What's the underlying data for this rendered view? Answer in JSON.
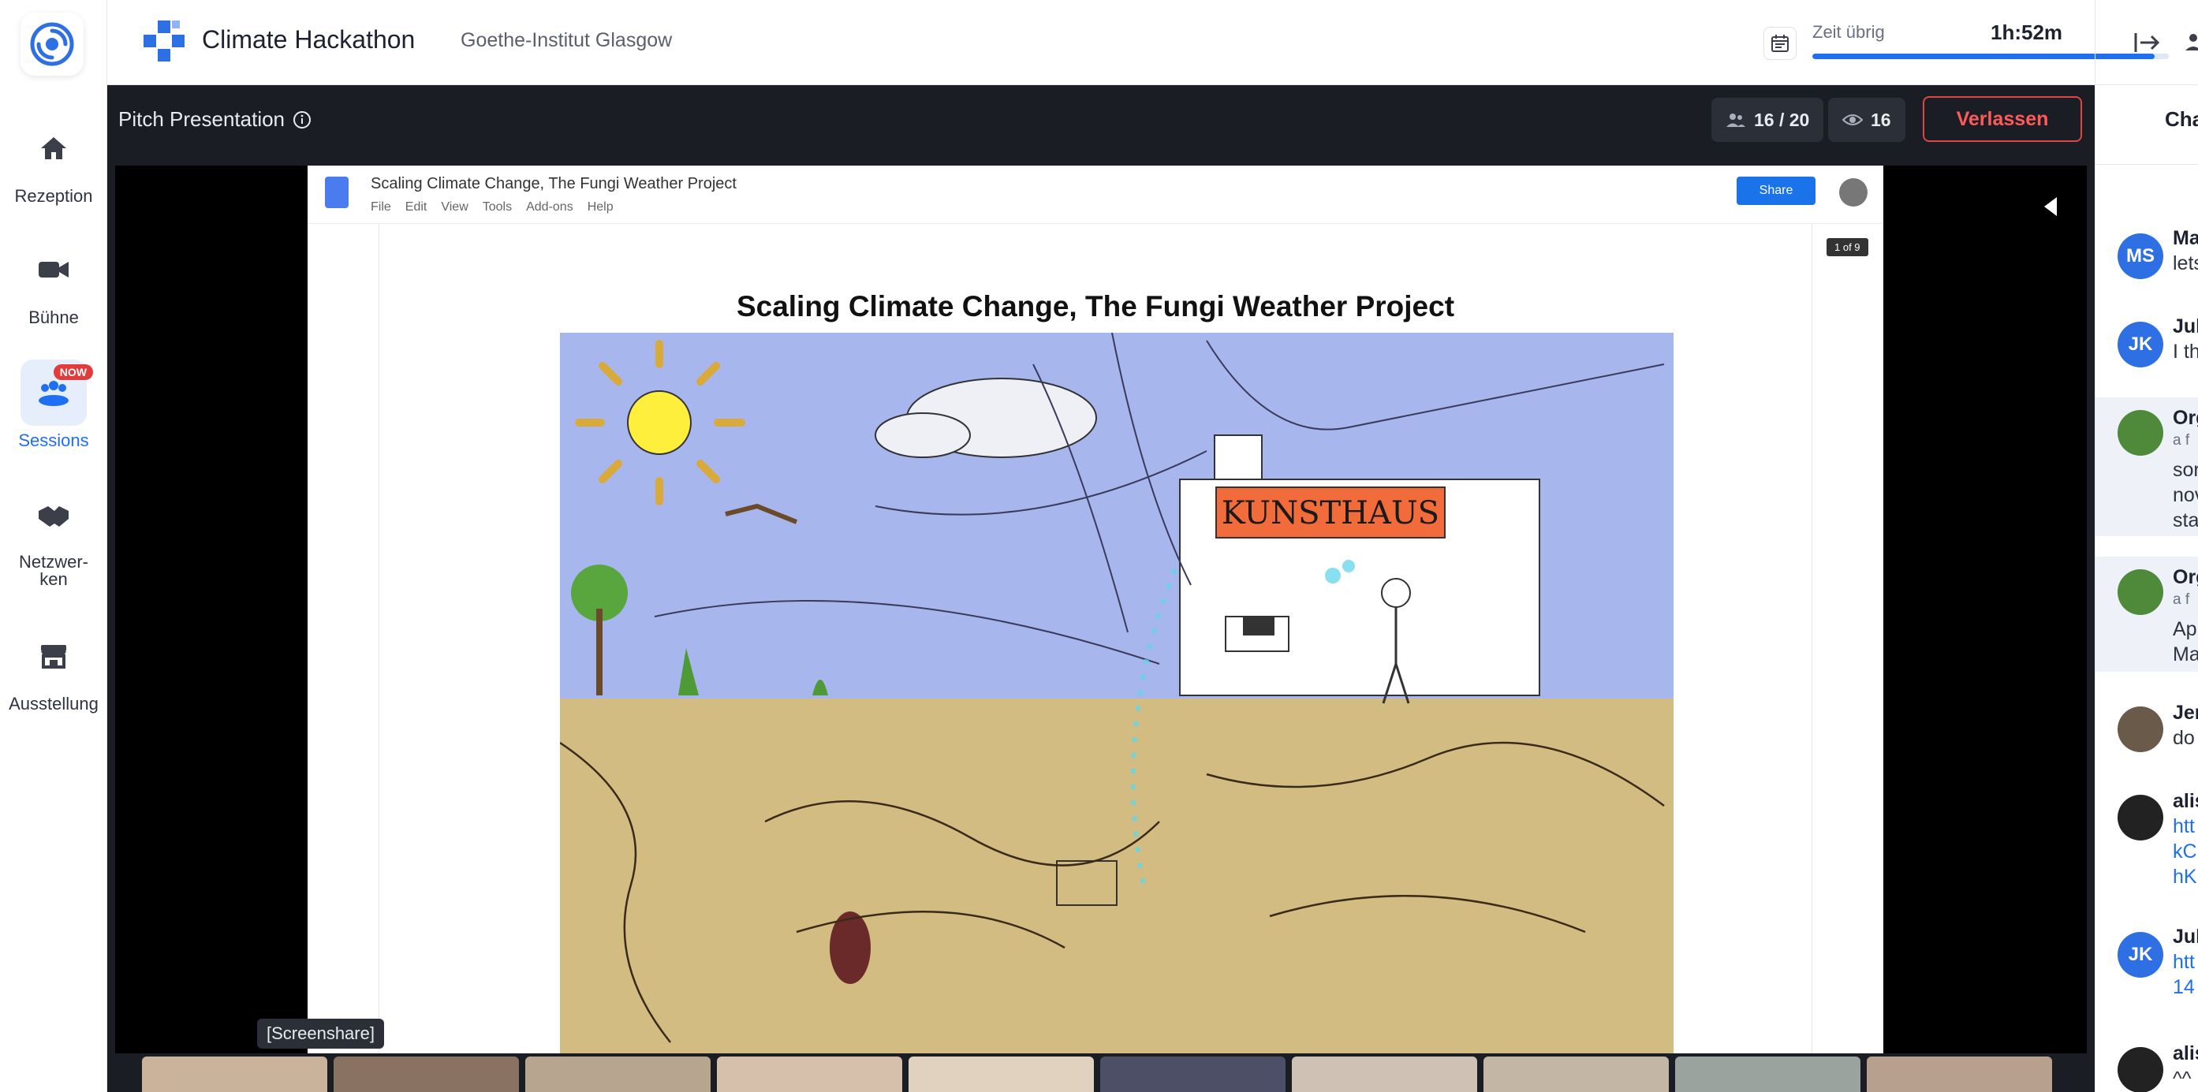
{
  "header": {
    "event_title": "Climate Hackathon",
    "organizer": "Goethe-Institut Glasgow",
    "time_label": "Zeit übrig",
    "time_value": "1h:52m",
    "time_progress": 0.96
  },
  "sidebar": {
    "items": [
      {
        "label": "Rezeption",
        "icon": "home-icon"
      },
      {
        "label": "Bühne",
        "icon": "video-camera-icon"
      },
      {
        "label": "Sessions",
        "icon": "sessions-icon",
        "badge": "NOW",
        "active": true
      },
      {
        "label": "Netzwer-\nken",
        "icon": "handshake-icon"
      },
      {
        "label": "Ausstellung",
        "icon": "booth-icon"
      }
    ]
  },
  "session": {
    "title": "Pitch Presentation",
    "participants": "16 / 20",
    "viewers": "16",
    "leave_label": "Verlassen",
    "screenshare_label": "[Screenshare]"
  },
  "shared_doc": {
    "doc_name": "Scaling Climate Change, The Fungi Weather Project",
    "menu": [
      "File",
      "Edit",
      "View",
      "Tools",
      "Add-ons",
      "Help"
    ],
    "share_label": "Share",
    "page_indicator": "1 of 9",
    "heading": "Scaling Climate Change, The Fungi Weather Project",
    "drawing_sign": "KUNSTHAUS"
  },
  "chat": {
    "tab_label": "Chat",
    "messages": [
      {
        "initials": "MS",
        "avatar_color": "#2f6fe4",
        "lines": [
          "Ma",
          "lets"
        ]
      },
      {
        "initials": "JK",
        "avatar_color": "#2f6fe4",
        "lines": [
          "Jul",
          "I th"
        ]
      },
      {
        "initials": "",
        "avatar_color": "#4f8a3a",
        "lines": [
          "Org",
          "a f",
          "sor",
          "nov",
          "sta"
        ],
        "pinned": true
      },
      {
        "initials": "",
        "avatar_color": "#4f8a3a",
        "lines": [
          "Org",
          "a f",
          "Ap",
          "Ma"
        ],
        "pinned": true
      },
      {
        "initials": "",
        "avatar_color": "#6a5a4a",
        "lines": [
          "Jer",
          "do"
        ]
      },
      {
        "initials": "",
        "avatar_color": "#222222",
        "lines": [
          "alis",
          "htt",
          "kC",
          "hK"
        ]
      },
      {
        "initials": "JK",
        "avatar_color": "#2f6fe4",
        "lines": [
          "Jul",
          "htt",
          "14"
        ]
      },
      {
        "initials": "",
        "avatar_color": "#222222",
        "lines": [
          "alis",
          "^^"
        ]
      }
    ]
  }
}
